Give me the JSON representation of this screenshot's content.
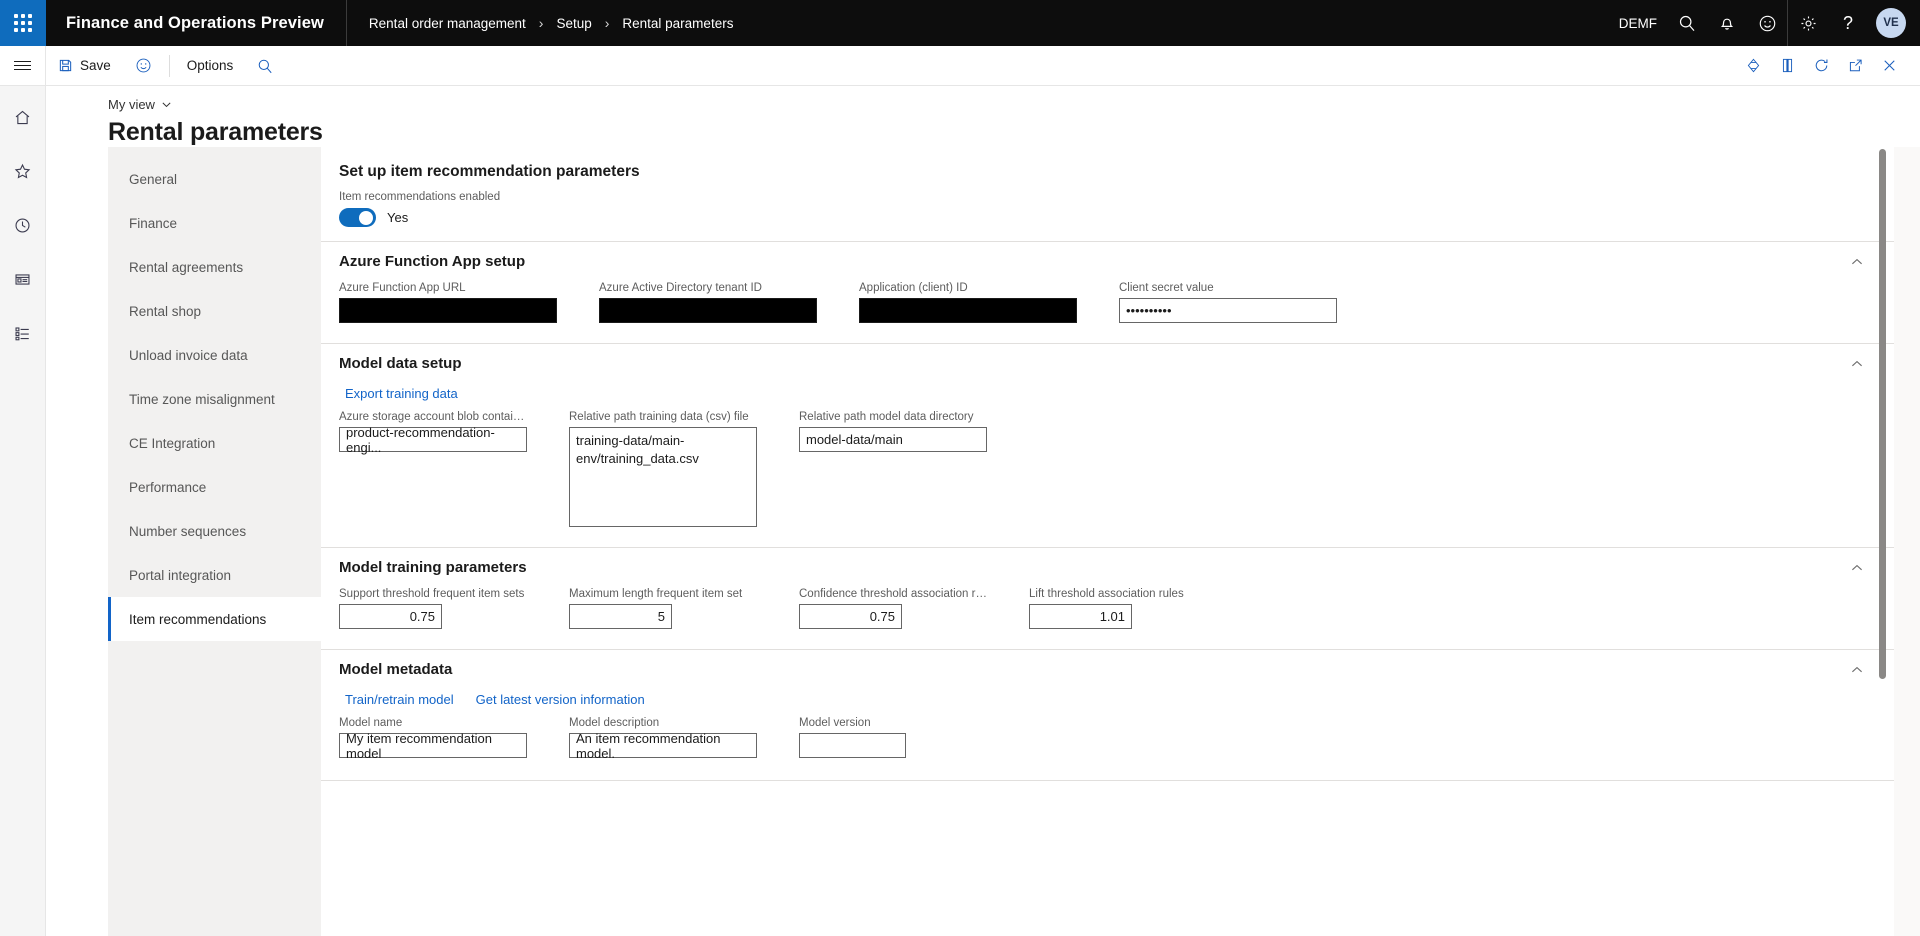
{
  "topbar": {
    "waffle_icon": "waffle-grid-icon",
    "app_title": "Finance and Operations Preview",
    "breadcrumb": [
      "Rental order management",
      "Setup",
      "Rental parameters"
    ],
    "breadcrumb_separator": "›",
    "company": "DEMF",
    "icons": [
      "search-icon",
      "notifications-bell-icon",
      "feedback-smiley-icon",
      "settings-gear-icon",
      "help-question-icon"
    ],
    "avatar_initials": "VE"
  },
  "toolbar": {
    "menu_icon": "hamburger-menu-icon",
    "save_label": "Save",
    "feedback_icon": "smiley-icon",
    "options_label": "Options",
    "search_icon": "search-icon",
    "right_icons": [
      "attachments-icon",
      "office-app-icon",
      "refresh-icon",
      "open-in-new-window-icon",
      "close-icon"
    ]
  },
  "rail": {
    "items": [
      "home-icon",
      "favorites-star-icon",
      "recent-clock-icon",
      "workspaces-icon",
      "modules-list-icon"
    ]
  },
  "page": {
    "view_selector": "My view",
    "view_chevron": "chevron-down-icon",
    "title": "Rental parameters"
  },
  "tabs": [
    {
      "label": "General",
      "active": false
    },
    {
      "label": "Finance",
      "active": false
    },
    {
      "label": "Rental agreements",
      "active": false
    },
    {
      "label": "Rental shop",
      "active": false
    },
    {
      "label": "Unload invoice data",
      "active": false
    },
    {
      "label": "Time zone misalignment",
      "active": false
    },
    {
      "label": "CE Integration",
      "active": false
    },
    {
      "label": "Performance",
      "active": false
    },
    {
      "label": "Number sequences",
      "active": false
    },
    {
      "label": "Portal integration",
      "active": false
    },
    {
      "label": "Item recommendations",
      "active": true
    }
  ],
  "form": {
    "section_title": "Set up item recommendation parameters",
    "enabled": {
      "label": "Item recommendations enabled",
      "value": "Yes",
      "on": true
    },
    "azure_setup": {
      "title": "Azure Function App setup",
      "collapse_icon": "chevron-up-icon",
      "fields": [
        {
          "label": "Azure Function App URL",
          "value": "",
          "redacted": true
        },
        {
          "label": "Azure Active Directory tenant ID",
          "value": "",
          "redacted": true
        },
        {
          "label": "Application (client) ID",
          "value": "",
          "redacted": true
        },
        {
          "label": "Client secret value",
          "value": "••••••••••",
          "redacted": false
        }
      ]
    },
    "model_data": {
      "title": "Model data setup",
      "collapse_icon": "chevron-up-icon",
      "link": "Export training data",
      "fields": [
        {
          "label": "Azure storage account blob container ...",
          "value": "product-recommendation-engi..."
        },
        {
          "label": "Relative path training data (csv) file",
          "value": "training-data/main-env/training_data.csv"
        },
        {
          "label": "Relative path model data directory",
          "value": "model-data/main"
        }
      ]
    },
    "training_params": {
      "title": "Model training parameters",
      "collapse_icon": "chevron-up-icon",
      "fields": [
        {
          "label": "Support threshold frequent item sets",
          "value": "0.75"
        },
        {
          "label": "Maximum length frequent item set",
          "value": "5"
        },
        {
          "label": "Confidence threshold association rules",
          "value": "0.75"
        },
        {
          "label": "Lift threshold association rules",
          "value": "1.01"
        }
      ]
    },
    "metadata": {
      "title": "Model metadata",
      "collapse_icon": "chevron-up-icon",
      "links": [
        "Train/retrain model",
        "Get latest version information"
      ],
      "fields": [
        {
          "label": "Model name",
          "value": "My item recommendation model"
        },
        {
          "label": "Model description",
          "value": "An item recommendation model."
        },
        {
          "label": "Model version",
          "value": ""
        }
      ]
    }
  },
  "colors": {
    "accent_blue": "#0f6cbd",
    "link_blue": "#1264c8",
    "topbar_black": "#0d0d0d",
    "tabrail_gray": "#f2f1f0"
  }
}
